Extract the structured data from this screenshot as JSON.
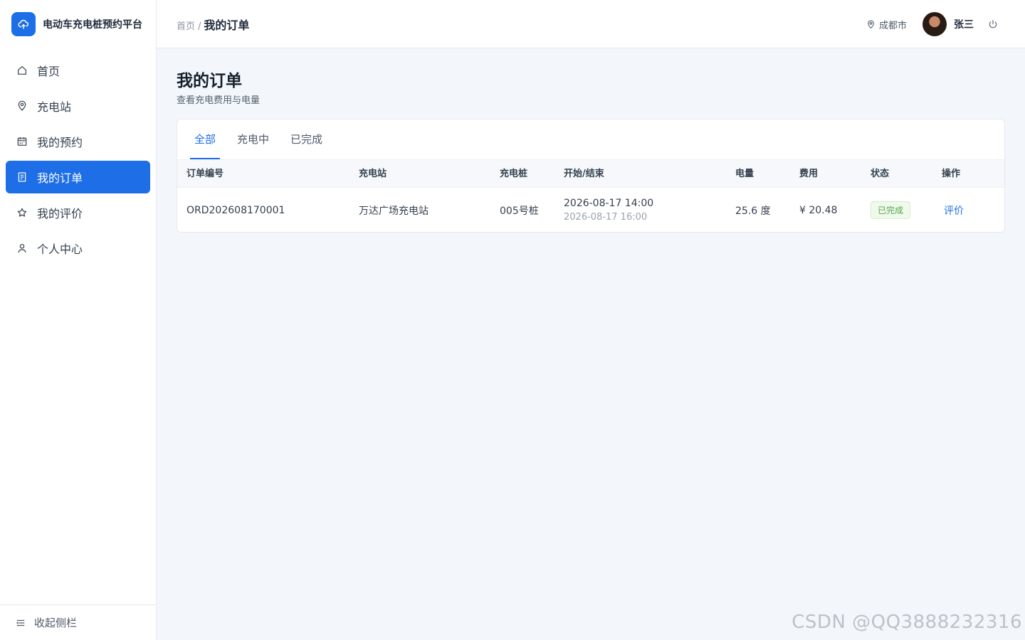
{
  "app": {
    "title": "电动车充电桩预约平台"
  },
  "sidebar": {
    "items": [
      {
        "label": "首页",
        "icon": "home-icon",
        "active": false
      },
      {
        "label": "充电站",
        "icon": "location-pin-icon",
        "active": false
      },
      {
        "label": "我的预约",
        "icon": "calendar-icon",
        "active": false
      },
      {
        "label": "我的订单",
        "icon": "document-icon",
        "active": true
      },
      {
        "label": "我的评价",
        "icon": "star-icon",
        "active": false
      },
      {
        "label": "个人中心",
        "icon": "user-icon",
        "active": false
      }
    ],
    "collapse_label": "收起侧栏"
  },
  "header": {
    "breadcrumb_home": "首页",
    "breadcrumb_sep": "/",
    "breadcrumb_current": "我的订单",
    "location": "成都市",
    "username": "张三"
  },
  "page": {
    "title": "我的订单",
    "subtitle": "查看充电费用与电量"
  },
  "tabs": [
    {
      "label": "全部",
      "active": true
    },
    {
      "label": "充电中",
      "active": false
    },
    {
      "label": "已完成",
      "active": false
    }
  ],
  "table": {
    "columns": [
      "订单编号",
      "充电站",
      "充电桩",
      "开始/结束",
      "电量",
      "费用",
      "状态",
      "操作"
    ],
    "rows": [
      {
        "order_no": "ORD202608170001",
        "station": "万达广场充电站",
        "pile": "005号桩",
        "start": "2026-08-17 14:00",
        "end": "2026-08-17 16:00",
        "energy": "25.6 度",
        "fee": "¥ 20.48",
        "status": "已完成",
        "action": "评价"
      }
    ]
  },
  "watermark": "CSDN @QQ3888232316",
  "colors": {
    "primary": "#1e6ee8",
    "success": "#52a84a",
    "background": "#f3f6fb"
  }
}
